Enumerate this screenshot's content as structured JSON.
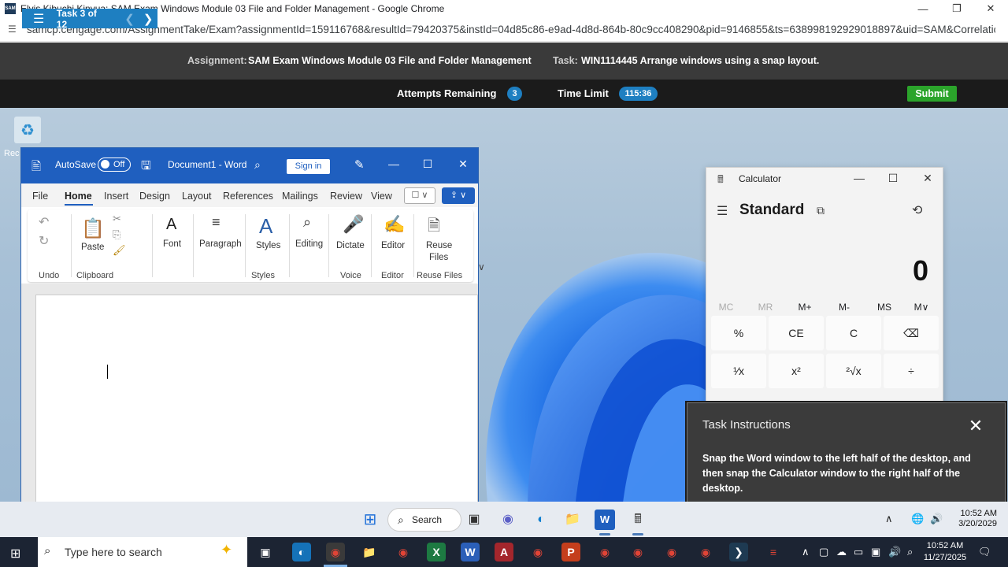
{
  "browser": {
    "title": "Elvis Kibuchi Kinyua: SAM Exam Windows Module 03 File and Folder Management - Google Chrome",
    "favicon_text": "SAM",
    "url": "samcp.cengage.com/AssignmentTake/Exam?assignmentId=159116768&resultId=79420375&instId=04d85c86-e9ad-4d8d-864b-80c9cc408290&pid=9146855&ts=638998192929018897&uid=SAM&CorrelationI..."
  },
  "sam": {
    "task_nav": "Task 3 of 12",
    "assignment_key": "Assignment:",
    "assignment_value": "SAM Exam Windows Module 03 File and Folder Management",
    "task_key": "Task:",
    "task_value": "WIN1114445 Arrange windows using a snap layout.",
    "attempts_label": "Attempts Remaining",
    "attempts_value": "3",
    "time_label": "Time Limit",
    "time_value": "115:36",
    "submit_label": "Submit"
  },
  "desktop": {
    "recycle_label": "Rec"
  },
  "word": {
    "autosave_label": "AutoSave",
    "autosave_state": "Off",
    "doc_title": "Document1 - Word",
    "signin_label": "Sign in",
    "menu": [
      "File",
      "Home",
      "Insert",
      "Design",
      "Layout",
      "References",
      "Mailings",
      "Review",
      "View"
    ],
    "ribbon": {
      "paste": "Paste",
      "font": "Font",
      "paragraph": "Paragraph",
      "styles": "Styles",
      "editing": "Editing",
      "dictate": "Dictate",
      "editor": "Editor",
      "reuse_line1": "Reuse",
      "reuse_line2": "Files",
      "groups": [
        "Undo",
        "Clipboard",
        "Styles",
        "Voice",
        "Editor",
        "Reuse Files"
      ]
    }
  },
  "calculator": {
    "title": "Calculator",
    "mode": "Standard",
    "display": "0",
    "memory": [
      "MC",
      "MR",
      "M+",
      "M-",
      "MS",
      "M∨"
    ],
    "keys_row1": [
      "%",
      "CE",
      "C",
      "⌫"
    ],
    "keys_row2": [
      "¹⁄x",
      "x²",
      "²√x",
      "÷"
    ]
  },
  "task_instructions": {
    "heading": "Task Instructions",
    "body": "Snap the Word window to the left half of the desktop, and then snap the Calculator window to the right half of the desktop."
  },
  "inner_taskbar": {
    "search_label": "Search",
    "time": "10:52 AM",
    "date": "3/20/2029"
  },
  "outer_taskbar": {
    "search_placeholder": "Type here to search",
    "time": "10:52 AM",
    "date": "11/27/2025"
  }
}
